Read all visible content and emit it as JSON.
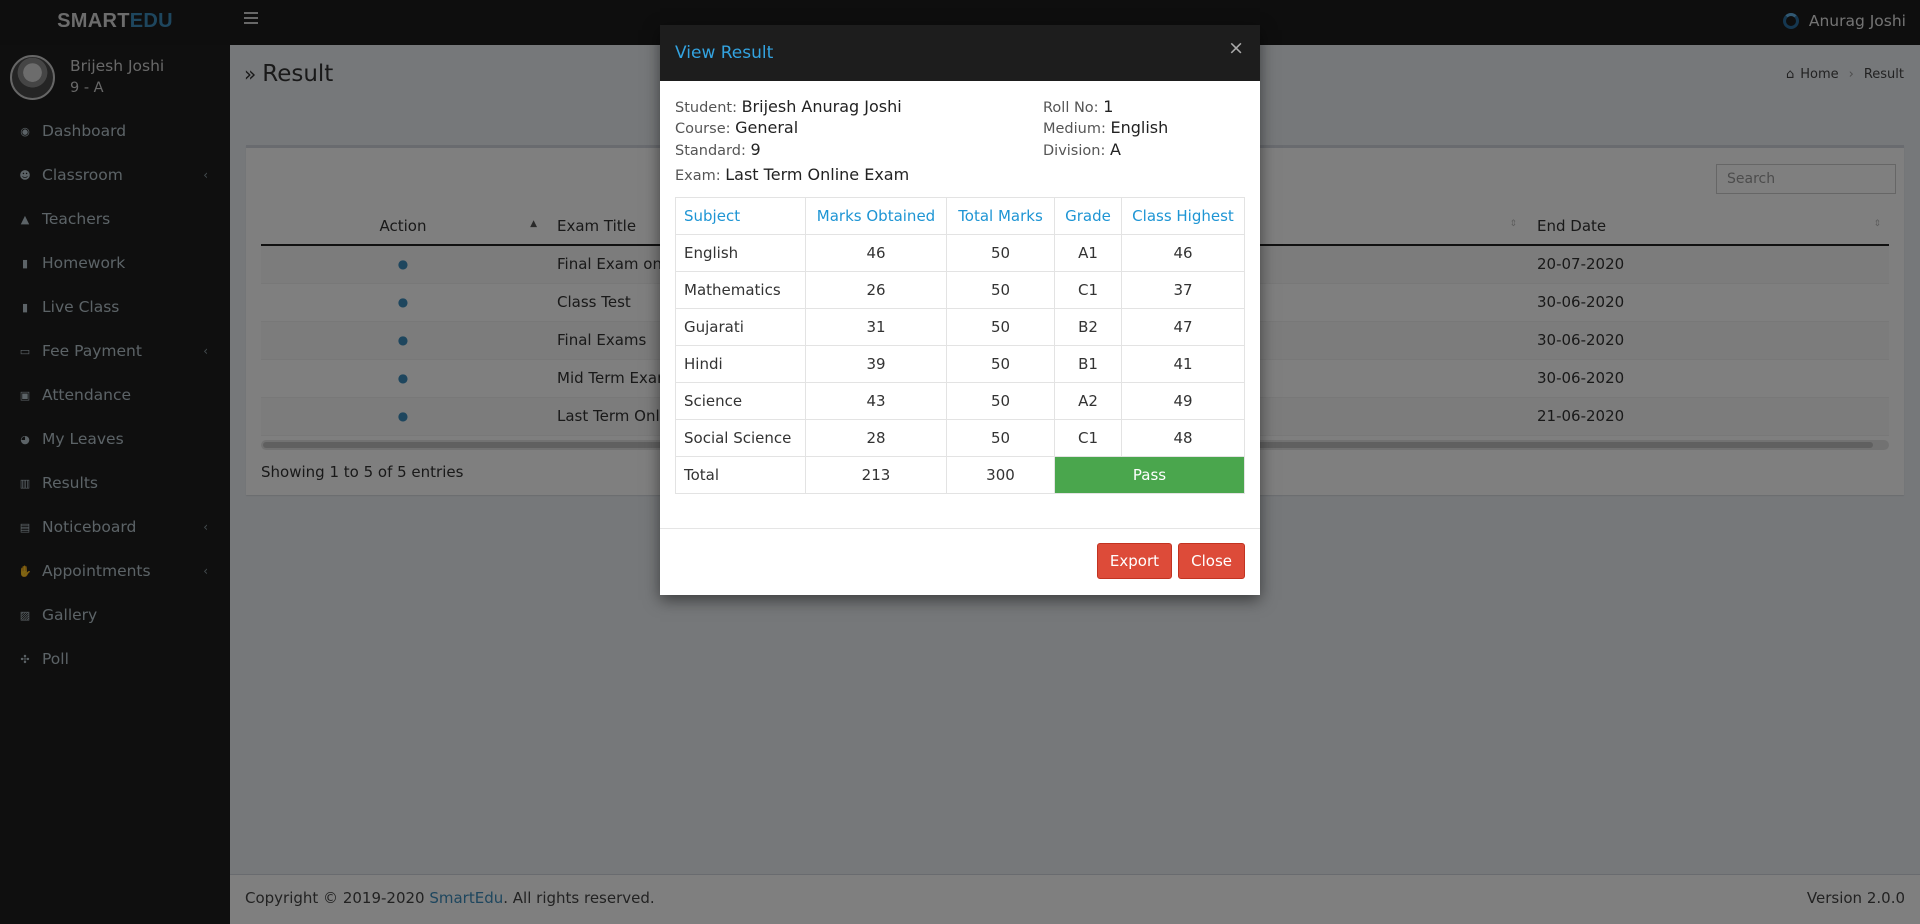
{
  "brand": {
    "part1": "SMART",
    "part2": "EDU"
  },
  "topbar": {
    "user_name": "Anurag Joshi"
  },
  "sidebar": {
    "user": {
      "name": "Brijesh Joshi",
      "class": "9 - A"
    },
    "items": [
      {
        "label": "Dashboard",
        "icon": "dashboard-icon",
        "arrow": ""
      },
      {
        "label": "Classroom",
        "icon": "users-icon",
        "arrow": "‹"
      },
      {
        "label": "Teachers",
        "icon": "graduation-cap-icon",
        "arrow": ""
      },
      {
        "label": "Homework",
        "icon": "book-icon",
        "arrow": ""
      },
      {
        "label": "Live Class",
        "icon": "book-icon",
        "arrow": ""
      },
      {
        "label": "Fee Payment",
        "icon": "credit-card-icon",
        "arrow": "‹"
      },
      {
        "label": "Attendance",
        "icon": "attendance-icon",
        "arrow": ""
      },
      {
        "label": "My Leaves",
        "icon": "pie-chart-icon",
        "arrow": ""
      },
      {
        "label": "Results",
        "icon": "bar-chart-icon",
        "arrow": ""
      },
      {
        "label": "Noticeboard",
        "icon": "file-icon",
        "arrow": "‹"
      },
      {
        "label": "Appointments",
        "icon": "handshake-icon",
        "arrow": "‹"
      },
      {
        "label": "Gallery",
        "icon": "image-icon",
        "arrow": ""
      },
      {
        "label": "Poll",
        "icon": "poll-icon",
        "arrow": ""
      }
    ]
  },
  "page": {
    "title": "Result",
    "breadcrumb": {
      "home": "Home",
      "current": "Result"
    },
    "search_placeholder": "Search",
    "table": {
      "headers": {
        "action": "Action",
        "exam_title": "Exam Title",
        "end_date": "End Date"
      },
      "rows": [
        {
          "title": "Final Exam onl",
          "end_date": "20-07-2020"
        },
        {
          "title": "Class Test",
          "end_date": "30-06-2020"
        },
        {
          "title": "Final Exams",
          "end_date": "30-06-2020"
        },
        {
          "title": "Mid Term Exam",
          "end_date": "30-06-2020"
        },
        {
          "title": "Last Term Onli",
          "end_date": "21-06-2020"
        }
      ]
    },
    "showing": "Showing 1 to 5 of 5 entries"
  },
  "footer": {
    "copyright": "Copyright © 2019-2020 ",
    "link": "SmartEdu",
    "rights": ". All rights reserved.",
    "version": "Version 2.0.0"
  },
  "modal": {
    "title": "View Result",
    "close_symbol": "×",
    "student_label": "Student:",
    "student": "Brijesh Anurag Joshi",
    "course_label": "Course:",
    "course": "General",
    "standard_label": "Standard:",
    "standard": "9",
    "exam_label": "Exam:",
    "exam": "Last Term Online Exam",
    "roll_label": "Roll No:",
    "roll": "1",
    "medium_label": "Medium:",
    "medium": "English",
    "division_label": "Division:",
    "division": "A",
    "headers": {
      "subject": "Subject",
      "obtained": "Marks Obtained",
      "total": "Total Marks",
      "grade": "Grade",
      "highest": "Class Highest"
    },
    "rows": [
      {
        "subject": "English",
        "obtained": "46",
        "total": "50",
        "grade": "A1",
        "highest": "46"
      },
      {
        "subject": "Mathematics",
        "obtained": "26",
        "total": "50",
        "grade": "C1",
        "highest": "37"
      },
      {
        "subject": "Gujarati",
        "obtained": "31",
        "total": "50",
        "grade": "B2",
        "highest": "47"
      },
      {
        "subject": "Hindi",
        "obtained": "39",
        "total": "50",
        "grade": "B1",
        "highest": "41"
      },
      {
        "subject": "Science",
        "obtained": "43",
        "total": "50",
        "grade": "A2",
        "highest": "49"
      },
      {
        "subject": "Social Science",
        "obtained": "28",
        "total": "50",
        "grade": "C1",
        "highest": "48"
      }
    ],
    "total": {
      "label": "Total",
      "obtained": "213",
      "total": "300",
      "status": "Pass"
    },
    "export_label": "Export",
    "close_label": "Close"
  }
}
